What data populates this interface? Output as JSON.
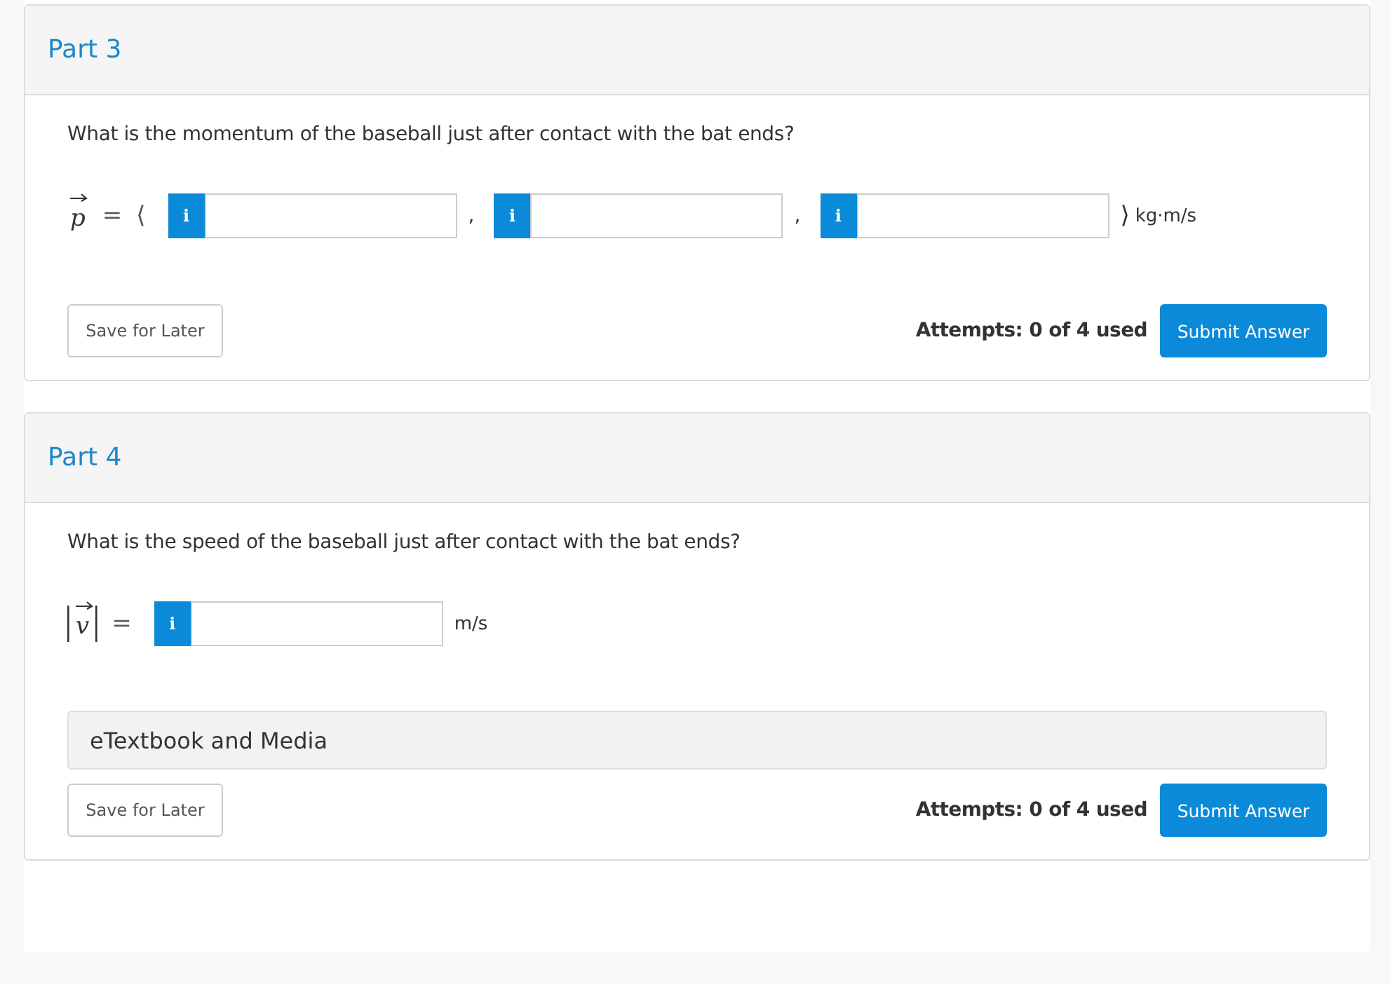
{
  "parts": [
    {
      "title": "Part 3",
      "question": "What is the momentum of the baseball just after contact with the bat ends?",
      "equation": {
        "kind": "vector",
        "symbol": "p",
        "equals": "=",
        "open": "⟨",
        "close": "⟩",
        "unit": "kg·m/s",
        "separator": ",",
        "fields": [
          {
            "info": "i"
          },
          {
            "info": "i"
          },
          {
            "info": "i"
          }
        ]
      },
      "save": "Save for Later",
      "attempts": "Attempts: 0 of 4 used",
      "submit": "Submit Answer"
    },
    {
      "title": "Part 4",
      "question": "What is the speed of the baseball just after contact with the bat ends?",
      "equation": {
        "kind": "magnitude",
        "symbol": "v",
        "equals": "=",
        "unit": "m/s",
        "fields": [
          {
            "info": "i"
          }
        ]
      },
      "media": "eTextbook and Media",
      "save": "Save for Later",
      "attempts": "Attempts: 0 of 4 used",
      "submit": "Submit Answer"
    }
  ]
}
